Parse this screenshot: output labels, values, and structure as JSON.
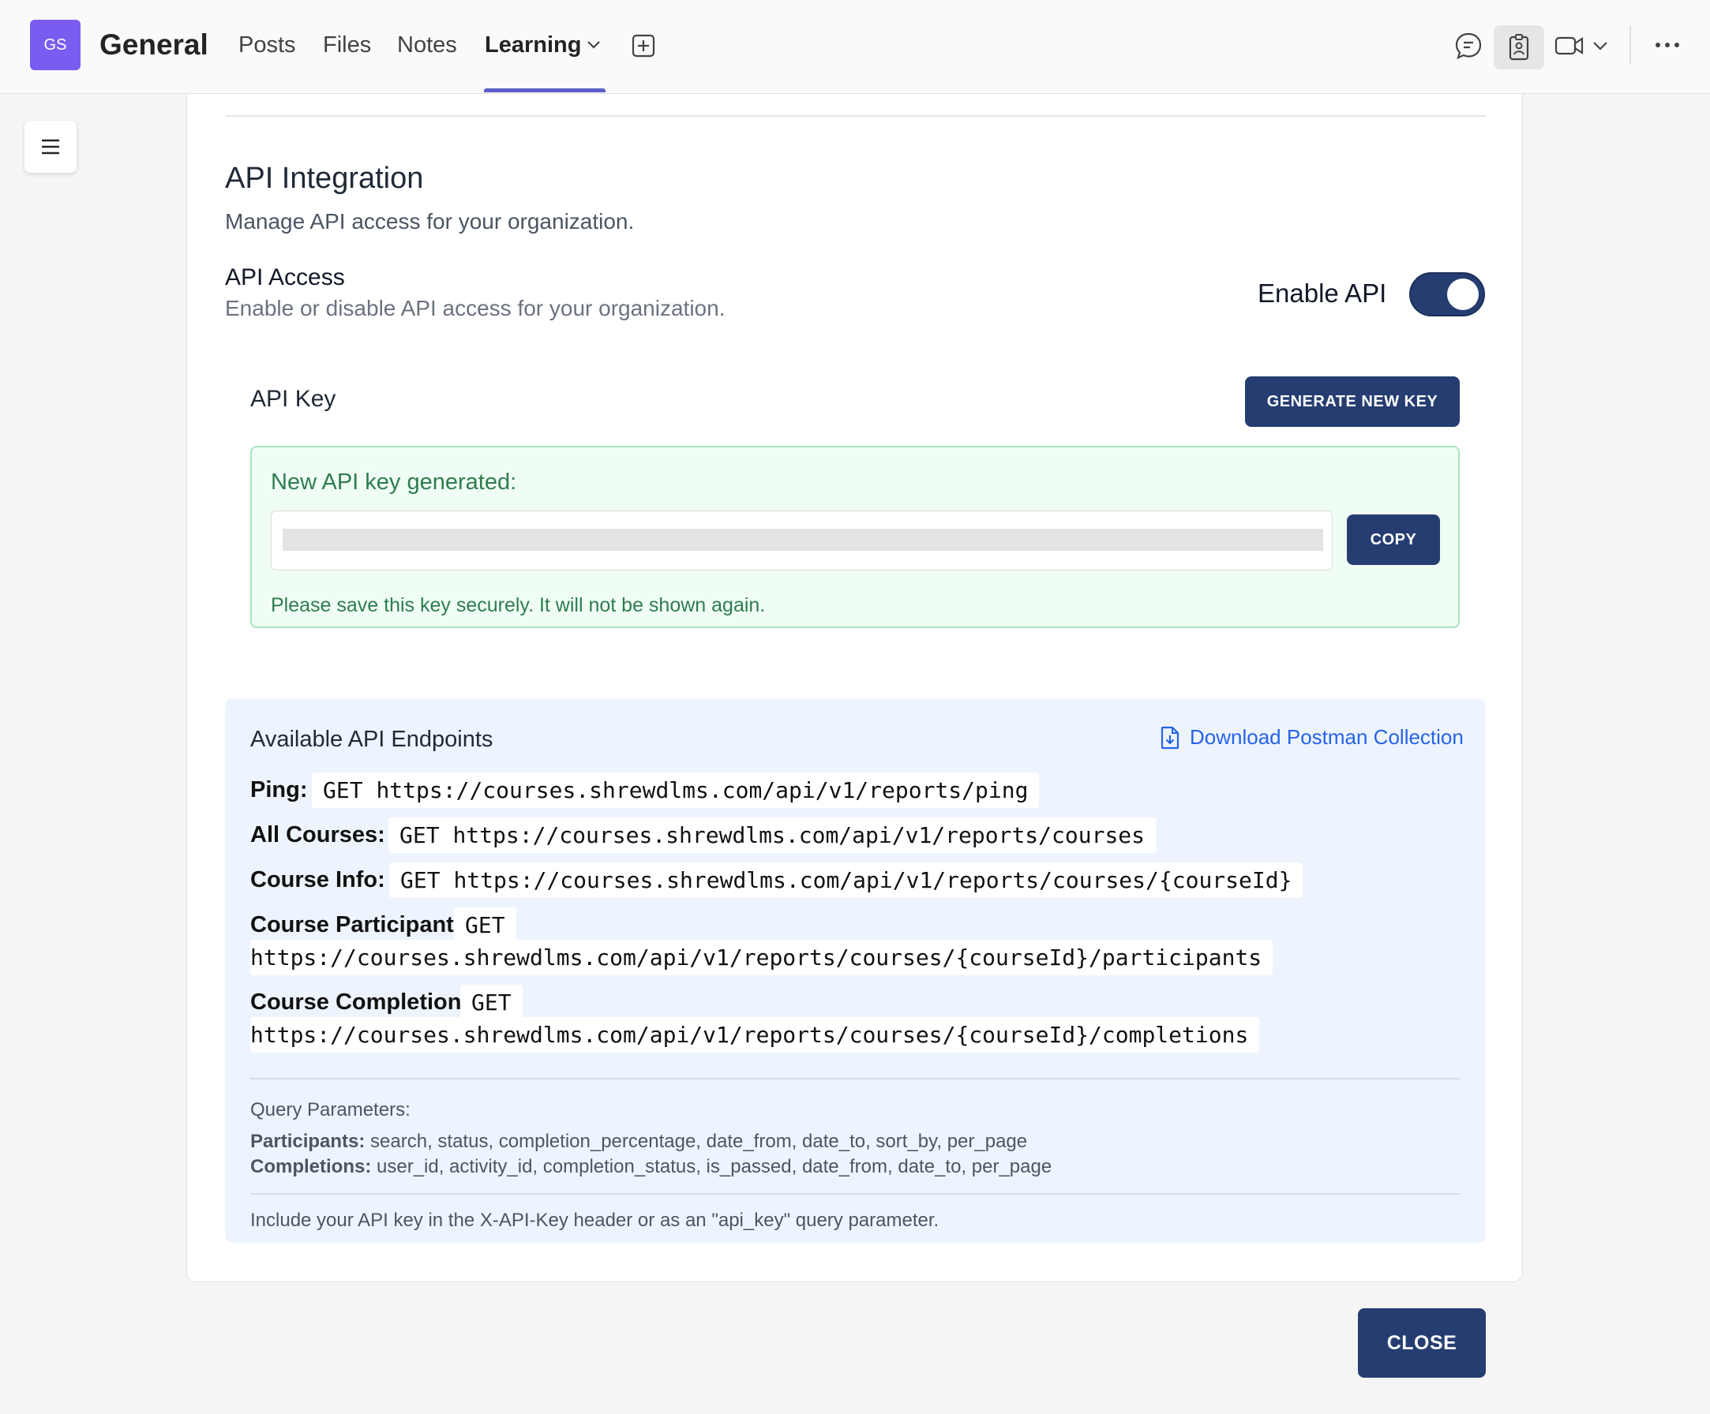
{
  "header": {
    "avatar_initials": "GS",
    "team_title": "General",
    "tabs": [
      {
        "label": "Posts"
      },
      {
        "label": "Files"
      },
      {
        "label": "Notes"
      },
      {
        "label": "Learning"
      }
    ],
    "active_tab": "Learning",
    "accent_color": "#5b5fc7"
  },
  "api": {
    "title": "API Integration",
    "subtitle": "Manage API access for your organization.",
    "access_title": "API Access",
    "access_subtitle": "Enable or disable API access for your organization.",
    "enable_label": "Enable API",
    "enabled": true,
    "key_title": "API Key",
    "generate_label": "GENERATE NEW KEY",
    "new_key_title": "New API key generated:",
    "copy_label": "COPY",
    "save_note": "Please save this key securely. It will not be shown again."
  },
  "endpoints": {
    "title": "Available API Endpoints",
    "postman_label": "Download Postman Collection",
    "items": [
      {
        "label": "Ping:",
        "method": "GET",
        "url": "https://courses.shrewdlms.com/api/v1/reports/ping"
      },
      {
        "label": "All Courses:",
        "method": "GET",
        "url": "https://courses.shrewdlms.com/api/v1/reports/courses"
      },
      {
        "label": "Course Info:",
        "method": "GET",
        "url": "https://courses.shrewdlms.com/api/v1/reports/courses/{courseId}"
      },
      {
        "label": "Course Participants:",
        "method": "GET",
        "url": "https://courses.shrewdlms.com/api/v1/reports/courses/{courseId}/participants"
      },
      {
        "label": "Course Completions:",
        "method": "GET",
        "url": "https://courses.shrewdlms.com/api/v1/reports/courses/{courseId}/completions"
      }
    ],
    "query_title": "Query Parameters:",
    "participants_label": "Participants:",
    "participants_params": "search, status, completion_percentage, date_from, date_to, sort_by, per_page",
    "completions_label": "Completions:",
    "completions_params": "user_id, activity_id, completion_status, is_passed, date_from, date_to, per_page",
    "include_note": "Include your API key in the X-API-Key header or as an \"api_key\" query parameter."
  },
  "footer": {
    "close_label": "CLOSE"
  },
  "colors": {
    "primary": "#263d71",
    "success_text": "#2e7d4f",
    "link": "#2563eb"
  }
}
